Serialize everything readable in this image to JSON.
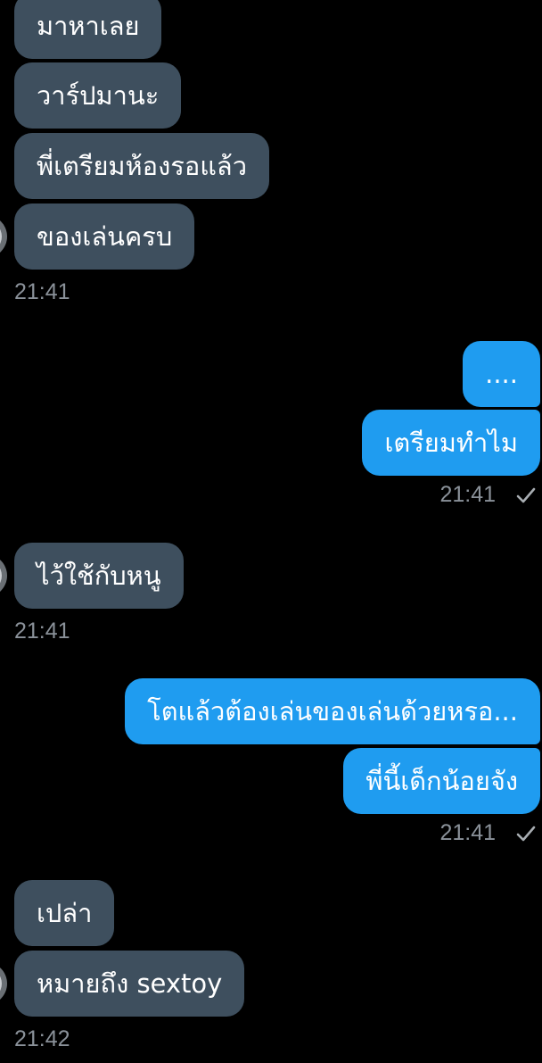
{
  "chat": {
    "messages": [
      {
        "from": "them",
        "text": "มาหาเลย"
      },
      {
        "from": "them",
        "text": "วาร์ปมานะ"
      },
      {
        "from": "them",
        "text": "พี่เตรียมห้องรอแล้ว"
      },
      {
        "from": "them",
        "text": "ของเล่นครบ"
      },
      {
        "from": "me",
        "text": "...."
      },
      {
        "from": "me",
        "text": "เตรียมทำไม"
      },
      {
        "from": "them",
        "text": "ไว้ใช้กับหนู"
      },
      {
        "from": "me",
        "text": "โตแล้วต้องเล่นของเล่นด้วยหรอ..."
      },
      {
        "from": "me",
        "text": "พี่นี้เด็กน้อยจัง"
      },
      {
        "from": "them",
        "text": "เปล่า"
      },
      {
        "from": "them",
        "text": "หมายถึง sextoy"
      }
    ],
    "timestamps": [
      "21:41",
      "21:41",
      "21:41",
      "21:41",
      "21:42"
    ]
  },
  "colors": {
    "incoming_bubble": "#3e4f5e",
    "outgoing_bubble": "#1f9cf0",
    "timestamp_text": "#8a9199",
    "background": "#000000"
  },
  "icons": {
    "read_receipt": "checkmark-icon",
    "sender_avatar": "avatar"
  }
}
